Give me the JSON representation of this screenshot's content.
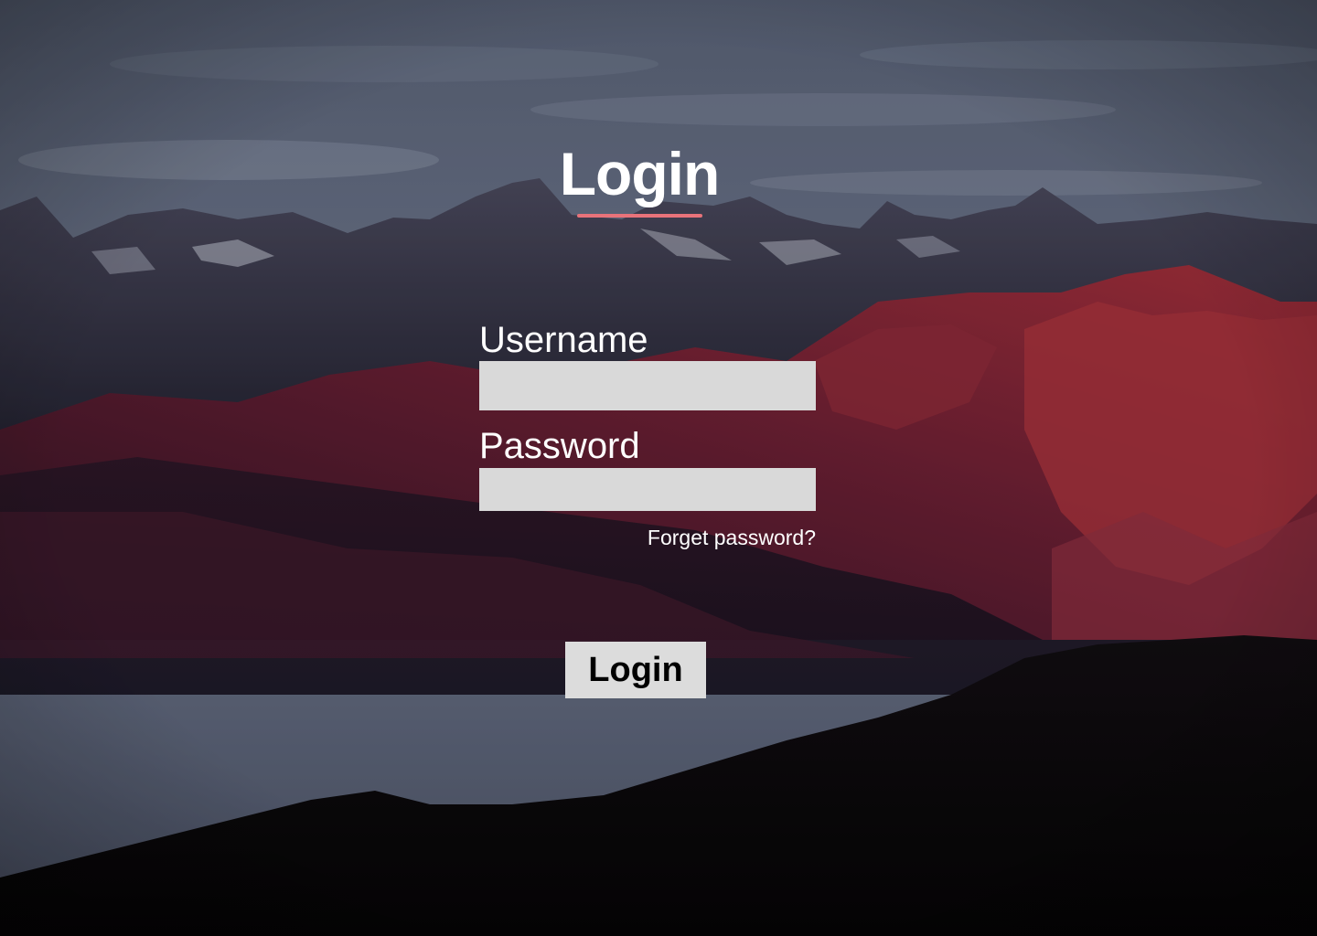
{
  "page": {
    "title": "Login",
    "background": "mountain-landscape-photo"
  },
  "form": {
    "username_label": "Username",
    "username_value": "",
    "password_label": "Password",
    "password_value": "",
    "forgot_link": "Forget password?",
    "submit_label": "Login"
  },
  "colors": {
    "accent_underline": "#e8737a",
    "input_background": "#d9d9d9",
    "button_background": "#dcdcdc",
    "text_on_background": "#ffffff"
  }
}
